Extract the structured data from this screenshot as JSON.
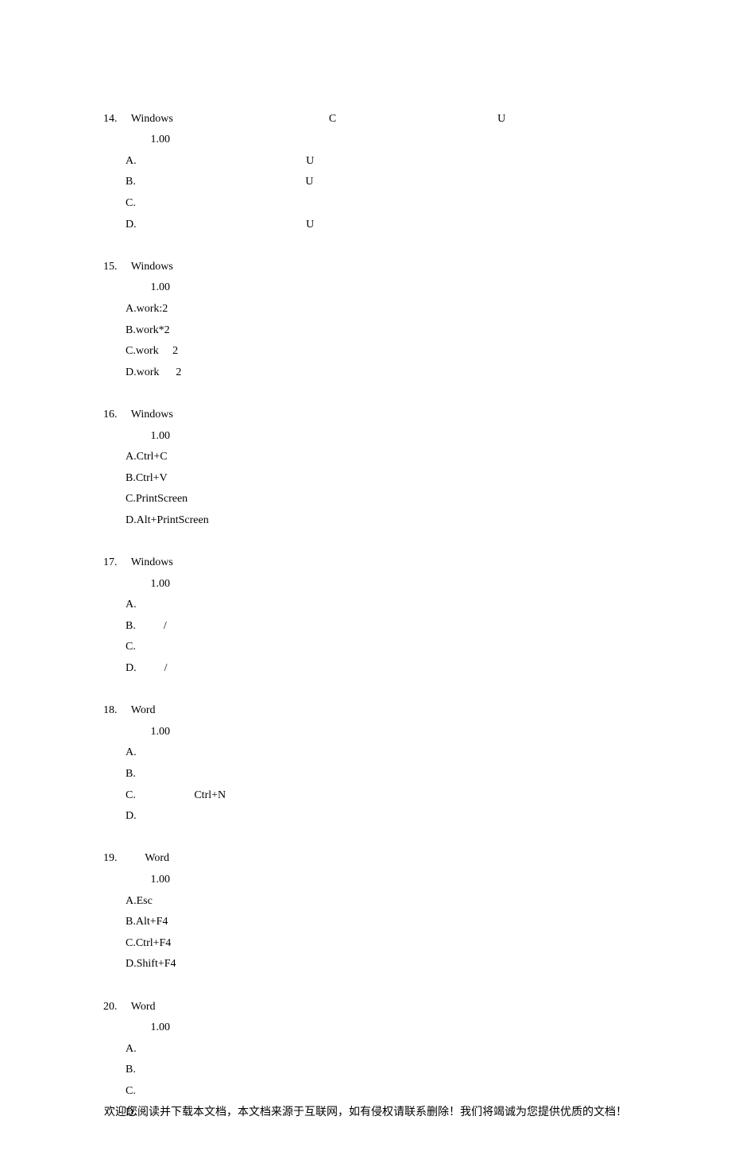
{
  "labels": {
    "isolate": "　　　",
    "score_prefix": "　　　　",
    "score_val": " 1.00　"
  },
  "questions": [
    {
      "num": "14.",
      "text": "　 Windows 　　　　　　　　　　　           C 　　　　　　　　　　　             U 　　　　　　　",
      "options": [
        {
          "label": "A.",
          "text": "　　　　　　　　　　　　             U 　　",
          "correct": true
        },
        {
          "label": "B.",
          "text": "　　　　　　　　　　　　             U 　　",
          "correct": false
        },
        {
          "label": "C.",
          "text": "　　　　　　　　　　",
          "correct": false
        },
        {
          "label": "D.",
          "text": "　　　　　　　　　　　　             U 　　　　　　　　　　",
          "correct": false
        }
      ]
    },
    {
      "num": "15.",
      "text": "　 Windows 　　　　　　　　　　　　",
      "options": [
        {
          "label": "A.",
          "text": "work:2",
          "correct": false
        },
        {
          "label": "B.",
          "text": "work*2",
          "correct": false
        },
        {
          "label": "C.",
          "text": "work　 2　",
          "correct": true
        },
        {
          "label": "D.",
          "text": "work　  2",
          "correct": false
        }
      ]
    },
    {
      "num": "16.",
      "text": "　 Windows 　　　　　　　　　　　　　　　　　　　　",
      "options": [
        {
          "label": "A.",
          "text": "Ctrl+C",
          "correct": false
        },
        {
          "label": "B.",
          "text": "Ctrl+V",
          "correct": false
        },
        {
          "label": "C.",
          "text": "PrintScreen",
          "correct": false
        },
        {
          "label": "D.",
          "text": "Alt+PrintScreen",
          "correct": true
        }
      ]
    },
    {
      "num": "17.",
      "text": "　 Windows 　　　　　　　　　　　　　　　　　　　　　　　　",
      "options": [
        {
          "label": "A.",
          "text": "　　",
          "correct": false
        },
        {
          "label": "B.",
          "text": "　　  /　　",
          "correct": false
        },
        {
          "label": "C.",
          "text": "　　　　",
          "correct": true
        },
        {
          "label": "D.",
          "text": "　　  /　　　　",
          "correct": false
        }
      ]
    },
    {
      "num": "18.",
      "text": "　 Word 　　　　　　　　　　　　　　　　　　",
      "options": [
        {
          "label": "A.",
          "text": "　　　　　　　　　　　　　　",
          "correct": false
        },
        {
          "label": "B.",
          "text": "　　　　　　　　　　　　　　　　　　",
          "correct": false
        },
        {
          "label": "C.",
          "text": "　　　　     Ctrl+N",
          "correct": false
        },
        {
          "label": "D.",
          "text": "　　　　　　　　　　　　　　",
          "trail": "                     ",
          "correct": true
        }
      ]
    },
    {
      "num": "19.",
      "text": "　　  Word 　　　　　　　　　　　",
      "options": [
        {
          "label": "A.",
          "text": "Esc",
          "correct": false
        },
        {
          "label": "B.",
          "text": "Alt+F4",
          "correct": true
        },
        {
          "label": "C.",
          "text": "Ctrl+F4",
          "correct": false
        },
        {
          "label": "D.",
          "text": "Shift+F4",
          "correct": false
        }
      ]
    },
    {
      "num": "20.",
      "text": "　 Word 　　　　　　　　　　　　　　　　　　　　　　　　　　　",
      "options": [
        {
          "label": "A.",
          "text": "　　　　",
          "correct": false
        },
        {
          "label": "B.",
          "text": "　　　　",
          "trail": "       ",
          "correct": true
        },
        {
          "label": "C.",
          "text": "　　　　",
          "correct": false
        },
        {
          "label": "D.",
          "text": "　　　　　　　",
          "correct": false
        }
      ],
      "no_trailing_isolate": true
    }
  ],
  "footer": "欢迎您阅读并下载本文档，本文档来源于互联网，如有侵权请联系删除！我们将竭诚为您提供优质的文档！"
}
